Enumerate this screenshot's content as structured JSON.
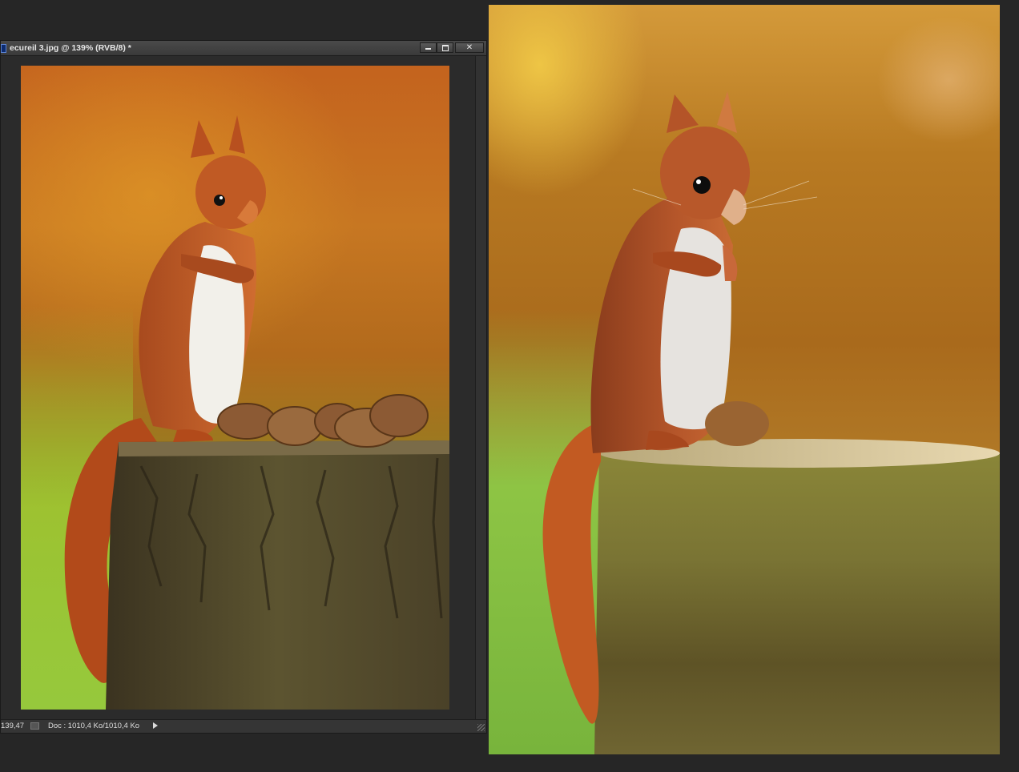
{
  "window": {
    "title": "ecureil 3.jpg @ 139% (RVB/8) *",
    "close_glyph": "✕"
  },
  "status_bar": {
    "zoom": "139,47",
    "doc_info": "Doc : 1010,4 Ko/1010,4 Ko"
  },
  "icons": {
    "app": "photoshop-icon",
    "minimize": "minimize-icon",
    "maximize": "maximize-icon",
    "close": "close-icon",
    "status": "status-icon",
    "menu": "triangle-right-icon"
  },
  "colors": {
    "workspace": "#262626",
    "title_bar": "#3f3f3f",
    "fur": "#c8612a",
    "belly": "#f1f1ee",
    "stump_photo": "#5a4f2c",
    "stump_painting": "#7b7633",
    "nut": "#9a6a3a"
  }
}
